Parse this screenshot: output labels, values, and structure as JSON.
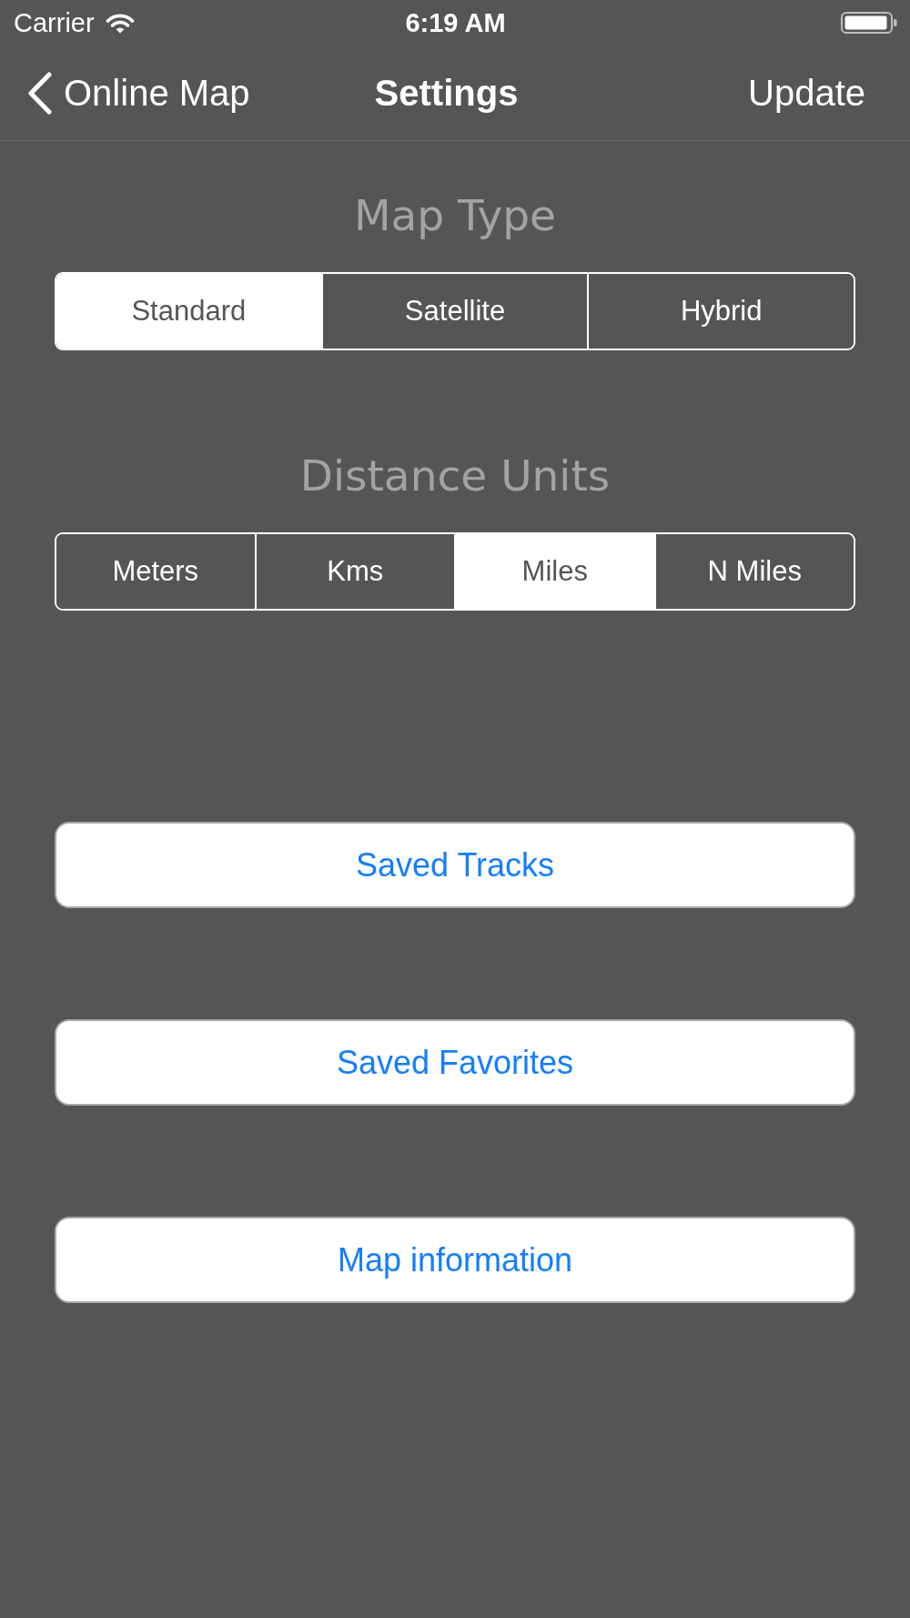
{
  "status_bar": {
    "carrier": "Carrier",
    "time": "6:19 AM"
  },
  "nav_bar": {
    "back_label": "Online Map",
    "title": "Settings",
    "action": "Update"
  },
  "sections": [
    {
      "title": "Map Type",
      "segments": [
        {
          "label": "Standard",
          "selected": true
        },
        {
          "label": "Satellite",
          "selected": false
        },
        {
          "label": "Hybrid",
          "selected": false
        }
      ]
    },
    {
      "title": "Distance Units",
      "segments": [
        {
          "label": "Meters",
          "selected": false
        },
        {
          "label": "Kms",
          "selected": false
        },
        {
          "label": "Miles",
          "selected": true
        },
        {
          "label": "N Miles",
          "selected": false
        }
      ]
    }
  ],
  "buttons": [
    "Saved Tracks",
    "Saved Favorites",
    "Map information"
  ]
}
